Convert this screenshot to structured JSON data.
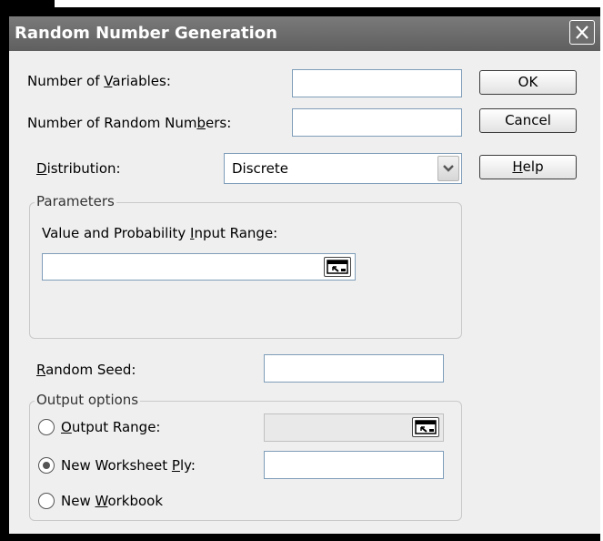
{
  "dialog": {
    "title": "Random Number Generation"
  },
  "fields": {
    "num_variables_pre": "Number of ",
    "num_variables_u": "V",
    "num_variables_post": "ariables:",
    "num_random_pre": "Number of Random Num",
    "num_random_u": "b",
    "num_random_post": "ers:",
    "distribution_u": "D",
    "distribution_post": "istribution:",
    "distribution_value": "Discrete",
    "random_seed_u": "R",
    "random_seed_post": "andom Seed:"
  },
  "buttons": {
    "ok": "OK",
    "cancel": "Cancel",
    "help_u": "H",
    "help_post": "elp"
  },
  "parameters": {
    "title": "Parameters",
    "label_pre": "Value and Probability ",
    "label_u": "I",
    "label_post": "nput Range:"
  },
  "output": {
    "title": "Output options",
    "output_range_u": "O",
    "output_range_post": "utput Range:",
    "new_ply_pre": "New Worksheet ",
    "new_ply_u": "P",
    "new_ply_post": "ly:",
    "new_workbook_pre": "New ",
    "new_workbook_u": "W",
    "new_workbook_post": "orkbook",
    "selected": "new_worksheet_ply"
  },
  "icons": {
    "close": "close-icon",
    "dropdown": "chevron-down-icon",
    "range_selector": "range-selector-icon"
  }
}
